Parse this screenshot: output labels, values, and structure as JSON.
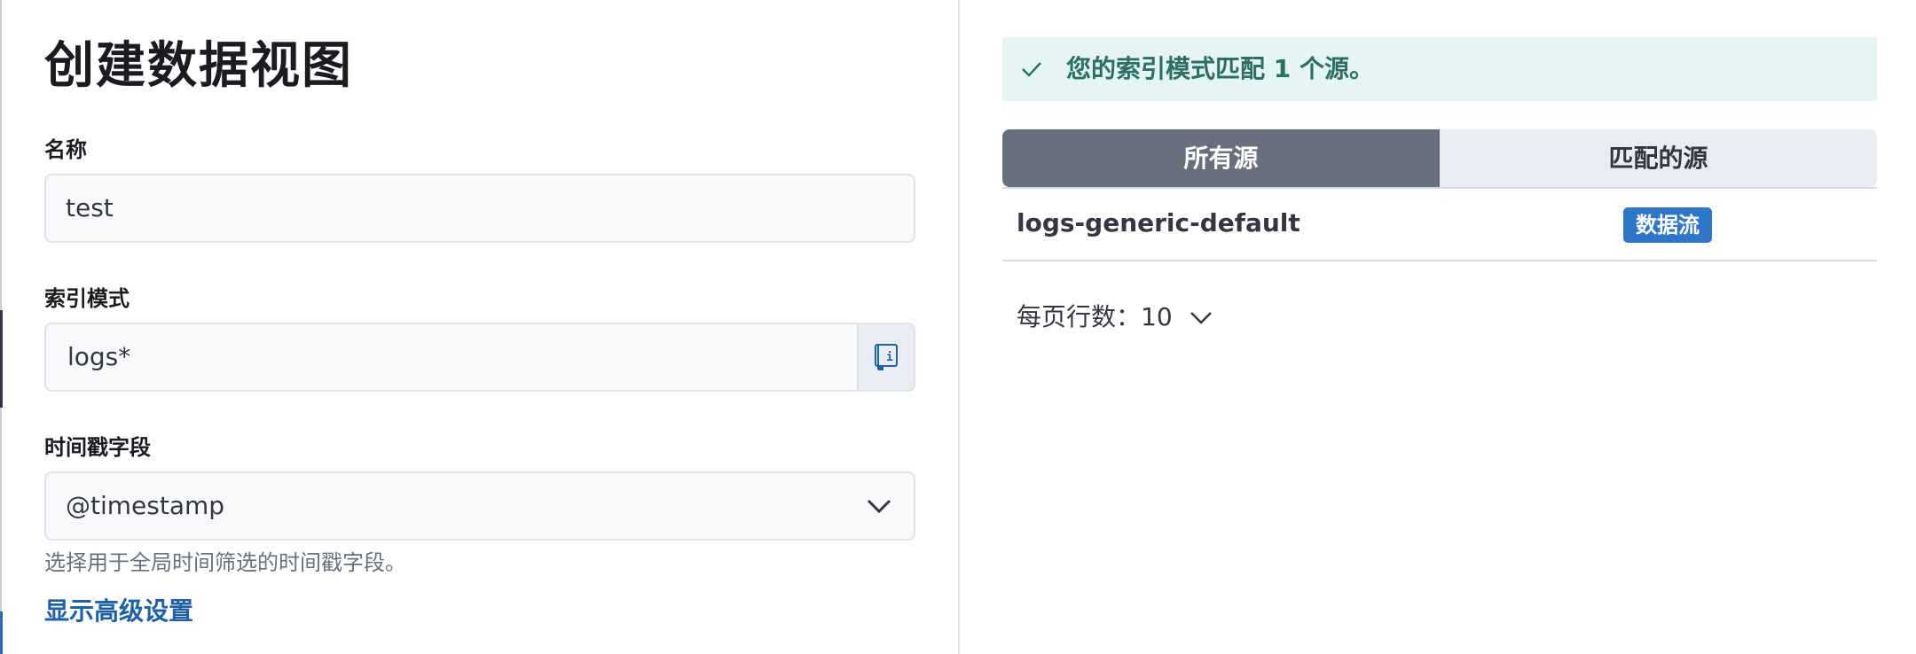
{
  "form": {
    "title": "创建数据视图",
    "name": {
      "label": "名称",
      "value": "test"
    },
    "index_pattern": {
      "label": "索引模式",
      "value": "logs*",
      "append_icon": "documentation-book-icon"
    },
    "timestamp": {
      "label": "时间戳字段",
      "value": "@timestamp",
      "help": "选择用于全局时间筛选的时间戳字段。"
    },
    "advanced_link": "显示高级设置"
  },
  "sources": {
    "callout": {
      "icon": "check-icon",
      "message": "您的索引模式匹配 1 个源。"
    },
    "tabs": [
      {
        "label": "所有源",
        "active": true
      },
      {
        "label": "匹配的源",
        "active": false
      }
    ],
    "rows": [
      {
        "name": "logs-generic-default",
        "badge": "数据流"
      }
    ],
    "rows_per_page": "每页行数：10"
  },
  "colors": {
    "accent_link": "#1f61a8",
    "badge": "#2f76c8",
    "callout_bg": "#e5f5f3",
    "callout_text": "#2c6f67",
    "active_tab": "#69707d"
  }
}
